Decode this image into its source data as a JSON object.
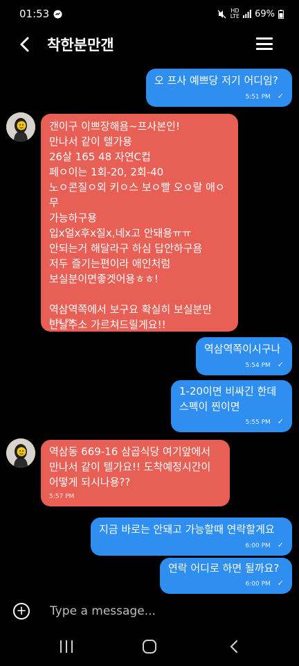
{
  "status_bar": {
    "time": "01:53",
    "network": "HD",
    "network_sub": "LTE",
    "battery": "69%"
  },
  "header": {
    "title": "착한분만갠"
  },
  "messages": [
    {
      "side": "sent",
      "text": "오 프사 예쁘당 저기 어디임?",
      "time": "5:51 PM",
      "status": "✓"
    },
    {
      "side": "received",
      "text": "갠이구 이쁘장해욤~프사본인!\n만나서 같이 텔가용\n26살 165 48 자연C컵\n페ㅇ이는 1회-20, 2회-40\n노ㅇ콘질ㅇ외 키ㅇ스 보ㅇ빨 오ㅇ랄 애ㅇ무\n가능하구용\n입x얼x후x질x,네x고 안돼용ㅠㅠ\n안되는거 해달라구 하심 답안하구욤\n저두 즐기는편이라 애인처럼\n보실분이면좋겟어용ㅎㅎ!\n\n역삼역쪽에서 보구요 확실히 보실분만\n만날주소 가르쳐드릴게요!!",
      "time": "5:51 PM"
    },
    {
      "side": "sent",
      "text": "역삼역쪽이시구나",
      "time": "5:54 PM",
      "status": "✓"
    },
    {
      "side": "sent",
      "text": "1-20이면 비싸긴 한데\n스펙이 찐이면",
      "time": "5:55 PM",
      "status": "✓"
    },
    {
      "side": "received",
      "text": "역삼동 669-16 삼곱식당 여기앞에서\n만나서 같이 텔가요!! 도착예정시간이\n어떻게 되시나용??",
      "time": "5:57 PM"
    },
    {
      "side": "sent",
      "text": "지금 바로는 안돼고 가능할때 연락할게요",
      "time": "6:00 PM",
      "status": "✓"
    },
    {
      "side": "sent",
      "text": "연락 어디로 하면 될까요?",
      "time": "6:00 PM",
      "status": "✓"
    }
  ],
  "composer": {
    "placeholder": "Type a message..."
  },
  "colors": {
    "sent": "#2f8ff0",
    "received": "#e85f56",
    "background": "#000000"
  },
  "icons": [
    "back-arrow-icon",
    "menu-icon",
    "add-icon",
    "avatar-image",
    "nav-recent-icon",
    "nav-home-icon",
    "nav-back-icon"
  ]
}
